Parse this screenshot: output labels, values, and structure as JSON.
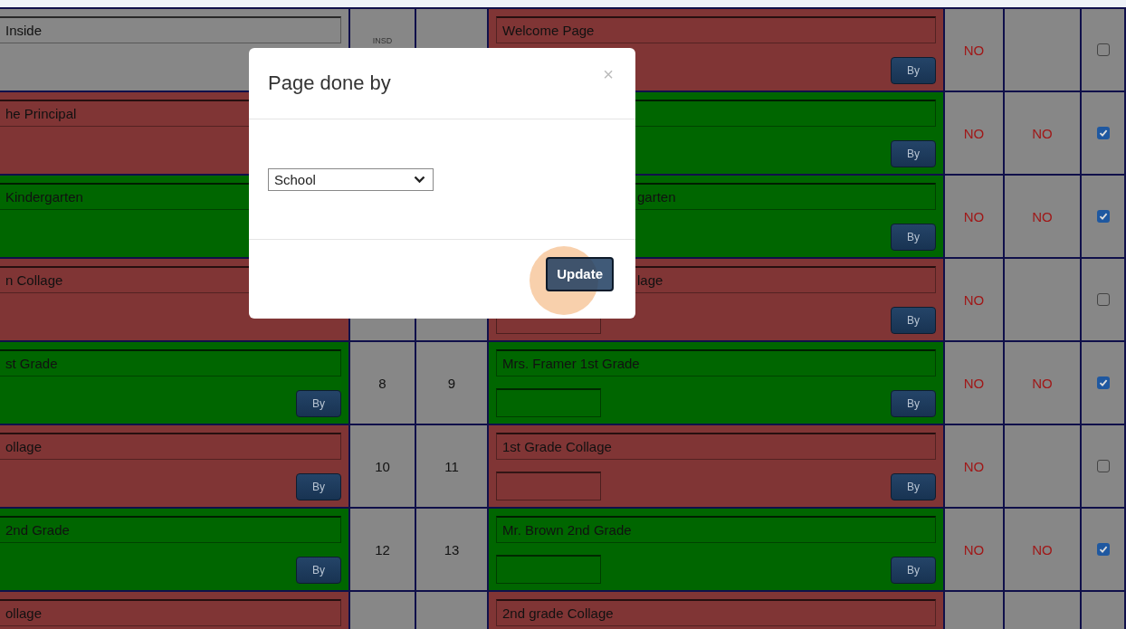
{
  "dialog": {
    "title": "Page done by",
    "close": "×",
    "select": {
      "value": "School"
    },
    "button": "Update"
  },
  "rows": [
    {
      "left": {
        "title": "Inside",
        "color": "#878787"
      },
      "num_1": "INSD",
      "right": {
        "title": "Welcome Page",
        "color": "#803535",
        "by": "By"
      },
      "col_1": "NO",
      "checked": false
    },
    {
      "left": {
        "title": "he Principal",
        "color": "#803535"
      },
      "right": {
        "color": "#006600",
        "by": "By"
      },
      "col_1": "NO",
      "col_2": "NO",
      "checked": true
    },
    {
      "left": {
        "title": "Kindergarten",
        "color": "#006600"
      },
      "right": {
        "title": "garten",
        "color": "#006600",
        "by": "By"
      },
      "col_1": "NO",
      "col_2": "NO",
      "checked": true
    },
    {
      "left": {
        "title": "n Collage",
        "color": "#803535"
      },
      "right": {
        "title": "lage",
        "color": "#803535",
        "by": "By"
      },
      "col_1": "NO",
      "checked": false
    },
    {
      "left": {
        "title": "st Grade",
        "color": "#006600",
        "by": "By"
      },
      "num_1": "8",
      "num_2": "9",
      "right": {
        "title": "Mrs. Framer 1st Grade",
        "color": "#006600",
        "by": "By"
      },
      "col_1": "NO",
      "col_2": "NO",
      "checked": true
    },
    {
      "left": {
        "title": "ollage",
        "color": "#803535",
        "by": "By"
      },
      "num_1": "10",
      "num_2": "11",
      "right": {
        "title": "1st Grade Collage",
        "color": "#803535",
        "by": "By"
      },
      "col_1": "NO",
      "checked": false
    },
    {
      "left": {
        "title": "2nd Grade",
        "color": "#006600",
        "by": "By"
      },
      "num_1": "12",
      "num_2": "13",
      "right": {
        "title": "Mr. Brown 2nd Grade",
        "color": "#006600",
        "by": "By"
      },
      "col_1": "NO",
      "col_2": "NO",
      "checked": true
    },
    {
      "left": {
        "title": "ollage",
        "color": "#803535"
      },
      "right": {
        "title": "2nd grade Collage",
        "color": "#803535"
      }
    }
  ]
}
